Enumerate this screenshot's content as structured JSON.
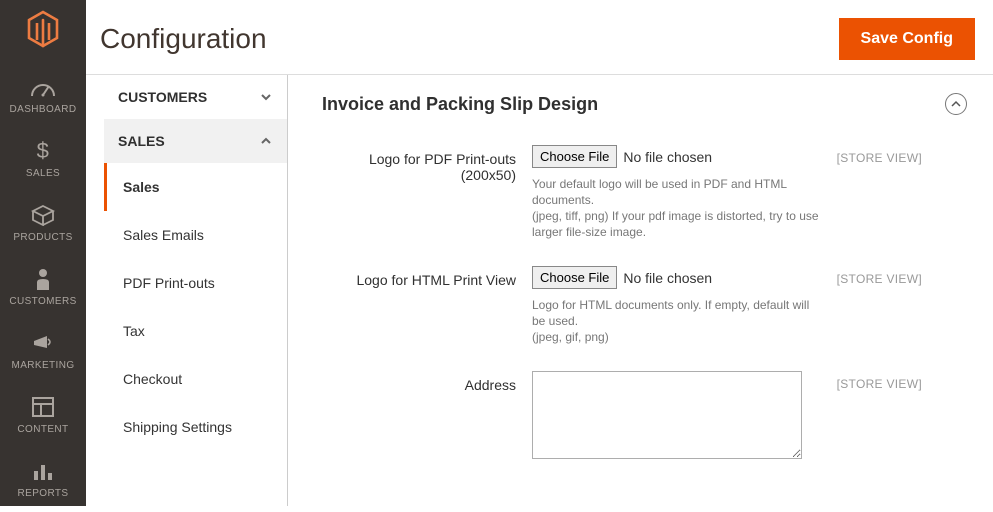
{
  "nav": {
    "items": [
      {
        "label": "DASHBOARD"
      },
      {
        "label": "SALES"
      },
      {
        "label": "PRODUCTS"
      },
      {
        "label": "CUSTOMERS"
      },
      {
        "label": "MARKETING"
      },
      {
        "label": "CONTENT"
      },
      {
        "label": "REPORTS"
      }
    ]
  },
  "header": {
    "title": "Configuration",
    "save_label": "Save Config"
  },
  "side": {
    "customers_label": "CUSTOMERS",
    "sales_label": "SALES",
    "subitems": [
      "Sales",
      "Sales Emails",
      "PDF Print-outs",
      "Tax",
      "Checkout",
      "Shipping Settings"
    ]
  },
  "section": {
    "title": "Invoice and Packing Slip Design",
    "scope_label": "[STORE VIEW]",
    "fields": {
      "logo_pdf": {
        "label": "Logo for PDF Print-outs (200x50)",
        "choose": "Choose File",
        "status": "No file chosen",
        "hint1": "Your default logo will be used in PDF and HTML documents.",
        "hint2": "(jpeg, tiff, png) If your pdf image is distorted, try to use larger file-size image."
      },
      "logo_html": {
        "label": "Logo for HTML Print View",
        "choose": "Choose File",
        "status": "No file chosen",
        "hint1": "Logo for HTML documents only. If empty, default will be used.",
        "hint2": "(jpeg, gif, png)"
      },
      "address": {
        "label": "Address",
        "value": ""
      }
    }
  }
}
